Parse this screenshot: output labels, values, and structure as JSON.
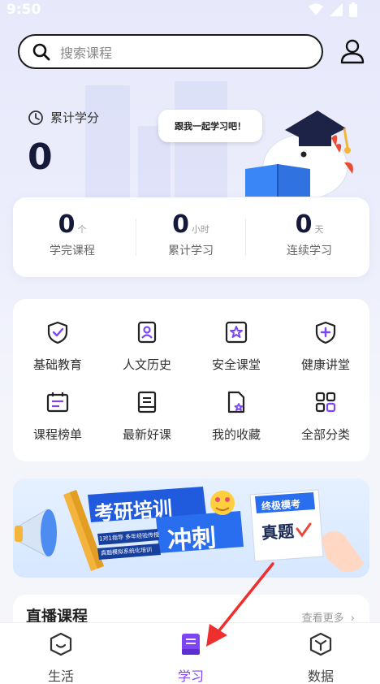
{
  "status_bar": {
    "time": "9:50"
  },
  "search": {
    "placeholder": "搜索课程"
  },
  "credits": {
    "label": "累计学分",
    "value": "0"
  },
  "mascot": {
    "bubble_text": "跟我一起学习吧！"
  },
  "stats": [
    {
      "value": "0",
      "unit": "个",
      "label": "学完课程"
    },
    {
      "value": "0",
      "unit": "小时",
      "label": "累计学习"
    },
    {
      "value": "0",
      "unit": "天",
      "label": "连续学习"
    }
  ],
  "categories": [
    {
      "label": "基础教育",
      "icon": "shield-check-icon"
    },
    {
      "label": "人文历史",
      "icon": "portrait-icon"
    },
    {
      "label": "安全课堂",
      "icon": "star-square-icon"
    },
    {
      "label": "健康讲堂",
      "icon": "shield-plus-icon"
    },
    {
      "label": "课程榜单",
      "icon": "calendar-list-icon"
    },
    {
      "label": "最新好课",
      "icon": "book-icon"
    },
    {
      "label": "我的收藏",
      "icon": "doc-star-icon"
    },
    {
      "label": "全部分类",
      "icon": "grid-icon"
    }
  ],
  "banner": {
    "title_main": "考研培训",
    "title_sub": "冲刺",
    "tag1": "1对1指导 多年经验传授",
    "tag2": "真题模拟系统化培训",
    "card_top": "终极模考",
    "card_main": "真题"
  },
  "live": {
    "title": "直播课程",
    "more": "查看更多"
  },
  "bottom_nav": [
    {
      "label": "生活",
      "icon": "smile-icon"
    },
    {
      "label": "学习",
      "icon": "book-icon"
    },
    {
      "label": "数据",
      "icon": "cube-icon"
    }
  ],
  "colors": {
    "accent": "#7d46f5",
    "heading": "#151a3a",
    "banner_blue": "#1f5bdc"
  }
}
